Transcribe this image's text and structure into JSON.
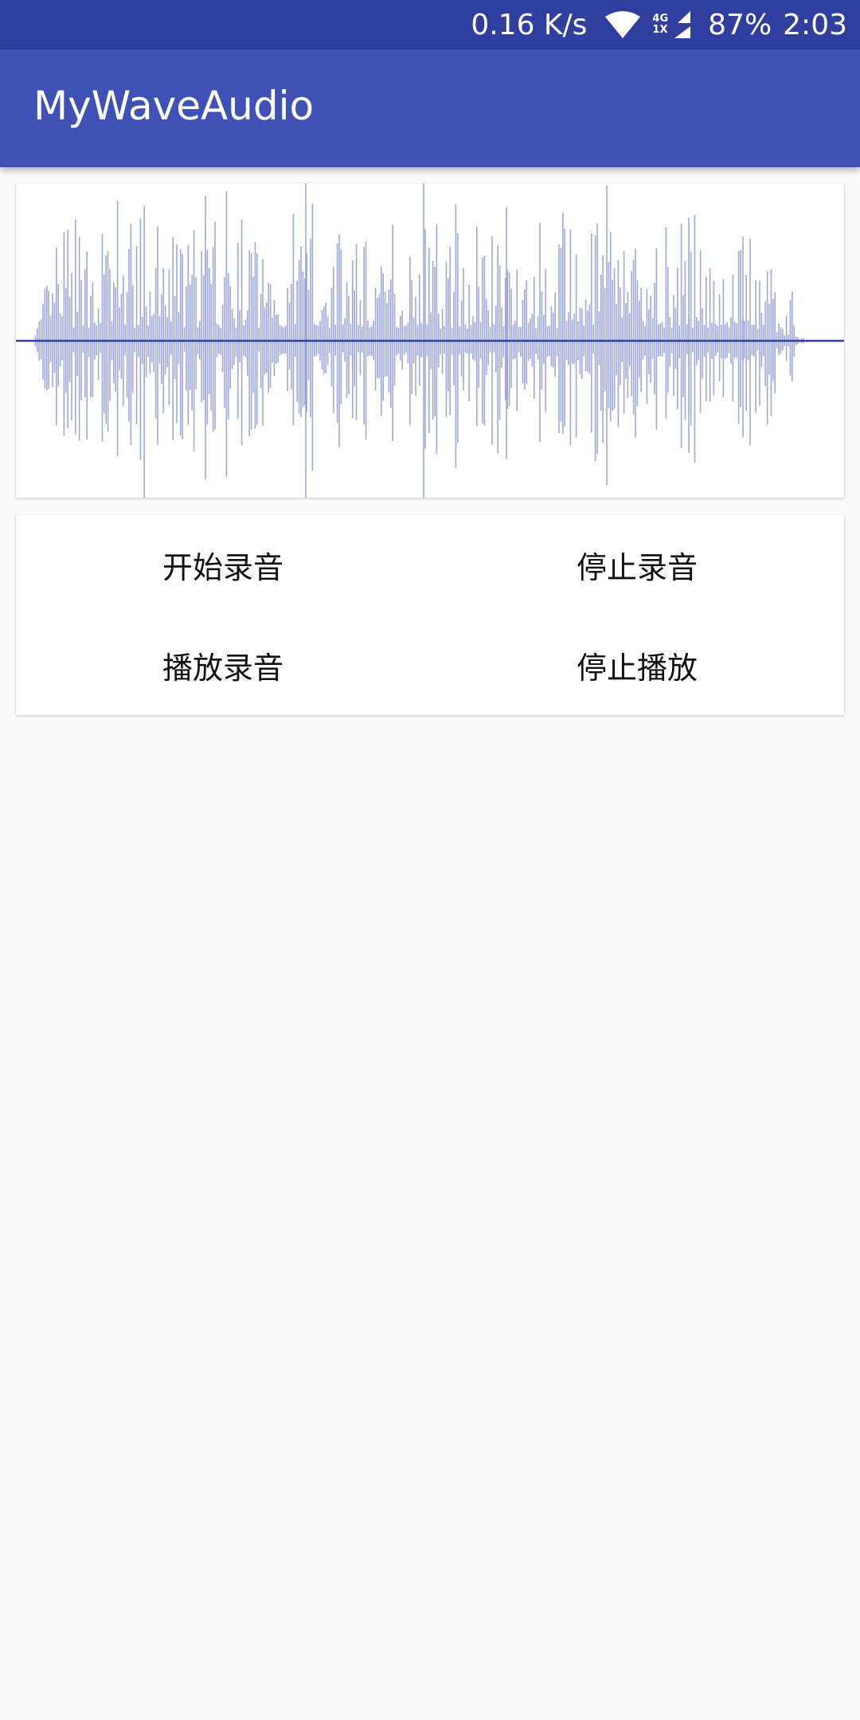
{
  "status_bar": {
    "net_speed": "0.16 K/s",
    "network_top": "4G",
    "network_bottom": "1X",
    "battery": "87%",
    "time": "2:03",
    "icons": [
      "wifi-icon",
      "cell-signal-icon"
    ]
  },
  "toolbar": {
    "title": "MyWaveAudio"
  },
  "buttons": {
    "start_record": "开始录音",
    "stop_record": "停止录音",
    "play_record": "播放录音",
    "stop_play": "停止播放"
  },
  "colors": {
    "status_bar": "#303f9f",
    "toolbar": "#3f51b5",
    "waveform": "#9fa8da",
    "center_line": "#303f9f",
    "background": "#fafafa"
  }
}
